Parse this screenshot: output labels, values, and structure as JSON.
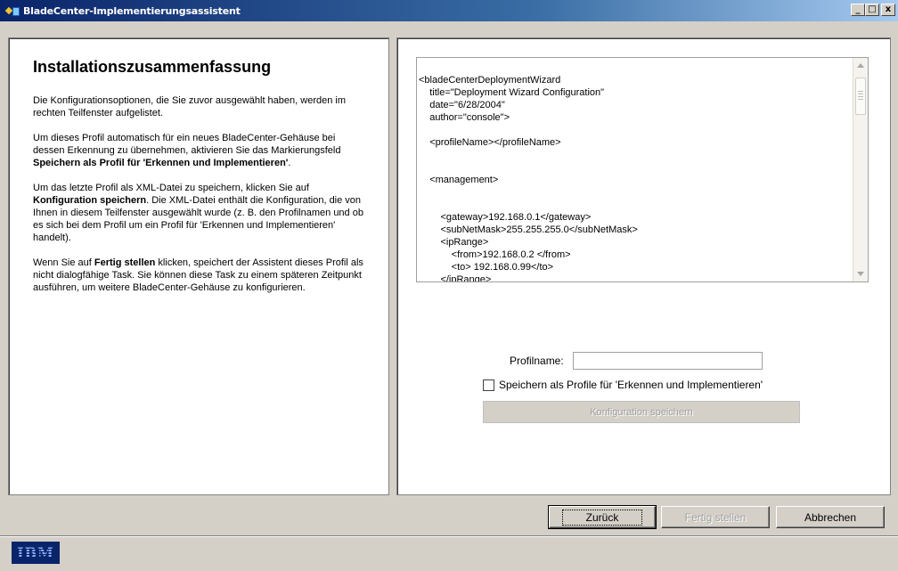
{
  "window": {
    "title": "BladeCenter-Implementierungsassistent",
    "minimize": "_",
    "maximize": "□",
    "close": "x"
  },
  "left_panel": {
    "heading": "Installationszusammenfassung",
    "p1": "Die Konfigurationsoptionen, die Sie zuvor ausgewählt haben, werden im rechten Teilfenster aufgelistet.",
    "p2_a": "Um dieses Profil automatisch für ein neues BladeCenter-Gehäuse bei dessen Erkennung zu übernehmen, aktivieren Sie das Markierungsfeld ",
    "p2_b": "Speichern als Profil für 'Erkennen und Implementieren'",
    "p2_c": ".",
    "p3_a": "Um das letzte Profil als XML-Datei zu speichern, klicken Sie auf ",
    "p3_b": "Konfiguration speichern",
    "p3_c": ". Die XML-Datei enthält die Konfiguration, die von Ihnen in diesem Teilfenster ausgewählt wurde (z. B. den Profilnamen und ob es sich bei dem Profil um ein Profil für 'Erkennen und Implementieren' handelt).",
    "p4_a": "Wenn Sie auf ",
    "p4_b": "Fertig stellen",
    "p4_c": " klicken, speichert der Assistent dieses Profil als nicht dialogfähige Task. Sie können diese Task zu einem späteren Zeitpunkt ausführen, um weitere BladeCenter-Gehäuse zu konfigurieren."
  },
  "xml": {
    "lines": [
      "<bladeCenterDeploymentWizard",
      "    title=\"Deployment Wizard Configuration\"",
      "    date=\"6/28/2004\"",
      "    author=\"console\">",
      "",
      "    <profileName></profileName>",
      "",
      "",
      "    <management>",
      "",
      "",
      "        <gateway>192.168.0.1</gateway>",
      "        <subNetMask>255.255.255.0</subNetMask>",
      "        <ipRange>",
      "            <from>192.168.0.2 </from>",
      "            <to> 192.168.0.99</to>",
      "        </ipRange>"
    ]
  },
  "form": {
    "profile_label": "Profilname:",
    "profile_value": "",
    "checkbox_label": "Speichern als Profile für 'Erkennen und Implementieren'",
    "save_button": "Konfiguration speichern"
  },
  "buttons": {
    "back": "Zurück",
    "finish": "Fertig stellen",
    "cancel": "Abbrechen"
  },
  "footer": {
    "logo": "IBM"
  }
}
